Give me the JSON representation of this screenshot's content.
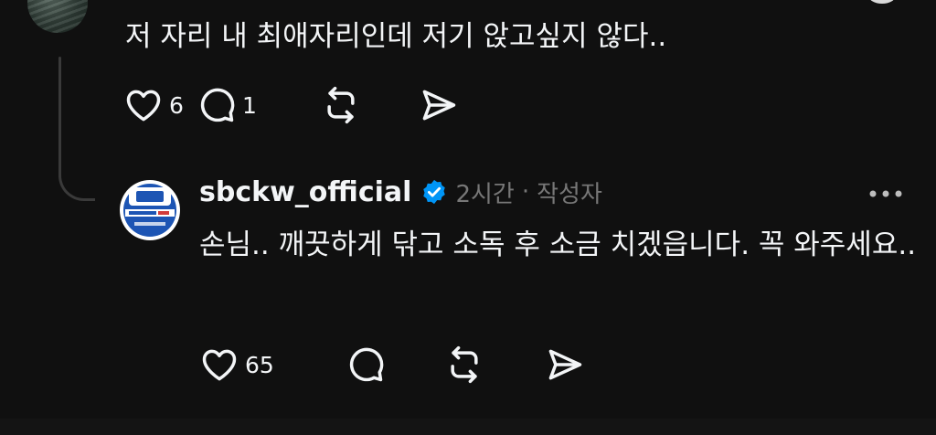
{
  "comment": {
    "text": "저 자리 내 최애자리인데 저기 앉고싶지 않다..",
    "actions": {
      "like_count": "6",
      "reply_count": "1"
    }
  },
  "reply": {
    "username": "sbckw_official",
    "timestamp": "2시간",
    "separator": "·",
    "author_tag": "작성자",
    "text": "손님.. 깨끗하게 닦고 소독 후 소금 치겠읍니다. 꼭 와주세요..",
    "actions": {
      "like_count": "65"
    }
  },
  "icons": {
    "like": "heart-icon",
    "reply": "speech-bubble-icon",
    "repost": "repost-icon",
    "share": "send-icon",
    "verified": "verified-badge-icon",
    "more": "more-options-icon"
  },
  "colors": {
    "background": "#101010",
    "text_primary": "#f3f5f7",
    "text_secondary": "#777777",
    "verified": "#0095f6",
    "thread_line": "#3a3a3a"
  }
}
